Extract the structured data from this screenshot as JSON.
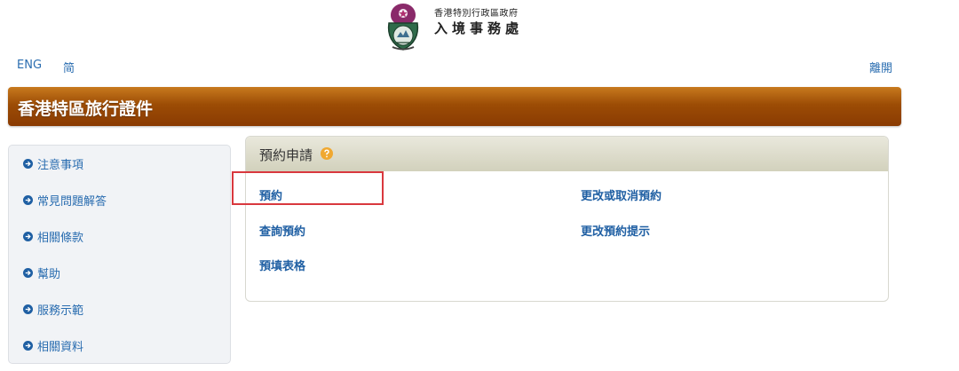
{
  "header": {
    "logo_line1": "香港特別行政區政府",
    "logo_line2": "入境事務處"
  },
  "topbar": {
    "lang_eng": "ENG",
    "lang_simplified": "简",
    "logout": "離開"
  },
  "banner": {
    "title": "香港特區旅行證件"
  },
  "sidebar": {
    "items": [
      {
        "label": "注意事項",
        "icon": "arrow-circle-right-icon"
      },
      {
        "label": "常見問題解答",
        "icon": "arrow-circle-right-icon"
      },
      {
        "label": "相關條款",
        "icon": "arrow-circle-right-icon"
      },
      {
        "label": "幫助",
        "icon": "arrow-circle-right-icon"
      },
      {
        "label": "服務示範",
        "icon": "arrow-circle-right-icon"
      },
      {
        "label": "相關資料",
        "icon": "arrow-circle-right-icon"
      }
    ]
  },
  "panel": {
    "title": "預約申請",
    "help_icon": "help-icon",
    "links": {
      "book": "預約",
      "change_cancel": "更改或取消預約",
      "enquire": "查詢預約",
      "reminder": "更改預約提示",
      "prefill": "預填表格"
    }
  },
  "colors": {
    "banner": "#9c4c05",
    "link": "#1f5fa3",
    "highlight": "#d9383e",
    "panel_header": "#d2d1bc"
  }
}
